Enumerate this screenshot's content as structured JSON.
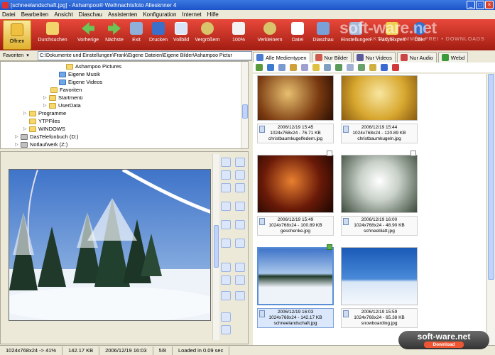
{
  "window": {
    "title": "[schneelandschaft.jpg] - Ashampoo® Weihnachtsfoto Allesknner 4",
    "buttons": [
      "_",
      "□",
      "×"
    ]
  },
  "menu": [
    "Datei",
    "Bearbeiten",
    "Ansicht",
    "Diaschau",
    "Assistenten",
    "Konfiguration",
    "Internet",
    "Hilfe"
  ],
  "toolbar": {
    "buttons": [
      {
        "label": "Öffnen",
        "icon": "open-folder-icon"
      },
      {
        "label": "Durchsuchen",
        "icon": "browse-icon"
      },
      {
        "label": "Vorherige",
        "icon": "arrow-left-icon"
      },
      {
        "label": "Nächste",
        "icon": "arrow-right-icon"
      },
      {
        "label": "Exit",
        "icon": "exit-icon"
      },
      {
        "label": "Drucken",
        "icon": "print-icon"
      },
      {
        "label": "Vollbild",
        "icon": "fullscreen-icon"
      },
      {
        "label": "Vergrößern",
        "icon": "zoom-in-icon"
      },
      {
        "label": "100%",
        "icon": "zoom-100-icon"
      },
      {
        "label": "Verkleinern",
        "icon": "zoom-out-icon"
      },
      {
        "label": "Datei",
        "icon": "file-icon"
      },
      {
        "label": "Diaschau",
        "icon": "slideshow-icon"
      },
      {
        "label": "Einstellungen",
        "icon": "settings-icon"
      },
      {
        "label": "Easy/Expert",
        "icon": "easy-expert-icon"
      },
      {
        "label": "Über",
        "icon": "about-icon"
      }
    ],
    "watermark": "soft-ware.net",
    "watermark_sub": "AKTUELL • IMMER FREI • DOWNLOADS"
  },
  "address": {
    "favorites_label": "Favoriten",
    "path": "C:\\Dokumente und Einstellungen\\Frank\\Eigene Dateien\\Eigene Bilder\\Ashampoo Pictur"
  },
  "tree": [
    {
      "label": "Ashampoo Pictures",
      "kind": "folder"
    },
    {
      "label": "Eigene Musik",
      "kind": "folder-blue"
    },
    {
      "label": "Eigene Videos",
      "kind": "folder-blue"
    },
    {
      "label": "Favoriten",
      "kind": "folder"
    },
    {
      "label": "Startmenü",
      "kind": "folder"
    },
    {
      "label": "UserData",
      "kind": "folder"
    },
    {
      "label": "Programme",
      "kind": "folder"
    },
    {
      "label": "YTPFiles",
      "kind": "folder"
    },
    {
      "label": "WINDOWS",
      "kind": "folder"
    },
    {
      "label": "DasTelefonbuch (D:)",
      "kind": "drive"
    },
    {
      "label": "Notlaufwerk (Z:)",
      "kind": "drive"
    }
  ],
  "tabs": [
    {
      "label": "Alle Medientypen",
      "color": "#4a7bd0"
    },
    {
      "label": "Nur Bilder",
      "color": "#d05a4a"
    },
    {
      "label": "Nur Videos",
      "color": "#5b5b9b"
    },
    {
      "label": "Nur Audio",
      "color": "#c44"
    },
    {
      "label": "Webd",
      "color": "#3a9a3a"
    }
  ],
  "thumbnails": [
    {
      "date": "2006/12/19 15:45",
      "info": "1024x768x24 - 76.71 KB",
      "name": "christbaumkugelfedern.jpg",
      "selected": false,
      "checked": false
    },
    {
      "date": "2006/12/19 15:44",
      "info": "1024x768x24 - 120.89 KB",
      "name": "christbaumkugeln.jpg",
      "selected": false,
      "checked": false
    },
    {
      "date": "2006/12/19 15:49",
      "info": "1024x768x24 - 100.89 KB",
      "name": "geschenke.jpg",
      "selected": false,
      "checked": false
    },
    {
      "date": "2006/12/19 16:00",
      "info": "1024x768x24 - 48.90 KB",
      "name": "schneeblatt.jpg",
      "selected": false,
      "checked": false
    },
    {
      "date": "2006/12/19 16:03",
      "info": "1024x768x24 - 142.17 KB",
      "name": "schneelandschaft.jpg",
      "selected": true,
      "checked": true
    },
    {
      "date": "2006/12/19 15:59",
      "info": "1024x768x24 - 65.38 KB",
      "name": "snowboarding.jpg",
      "selected": false,
      "checked": false
    }
  ],
  "status": {
    "dims": "1024x768x24 -> 41%",
    "size": "142.17 KB",
    "date": "2006/12/19 16:03",
    "index": "5/8",
    "load": "Loaded in 0.09 sec"
  },
  "badge": {
    "text": "soft-ware.net",
    "sub": "Download"
  }
}
